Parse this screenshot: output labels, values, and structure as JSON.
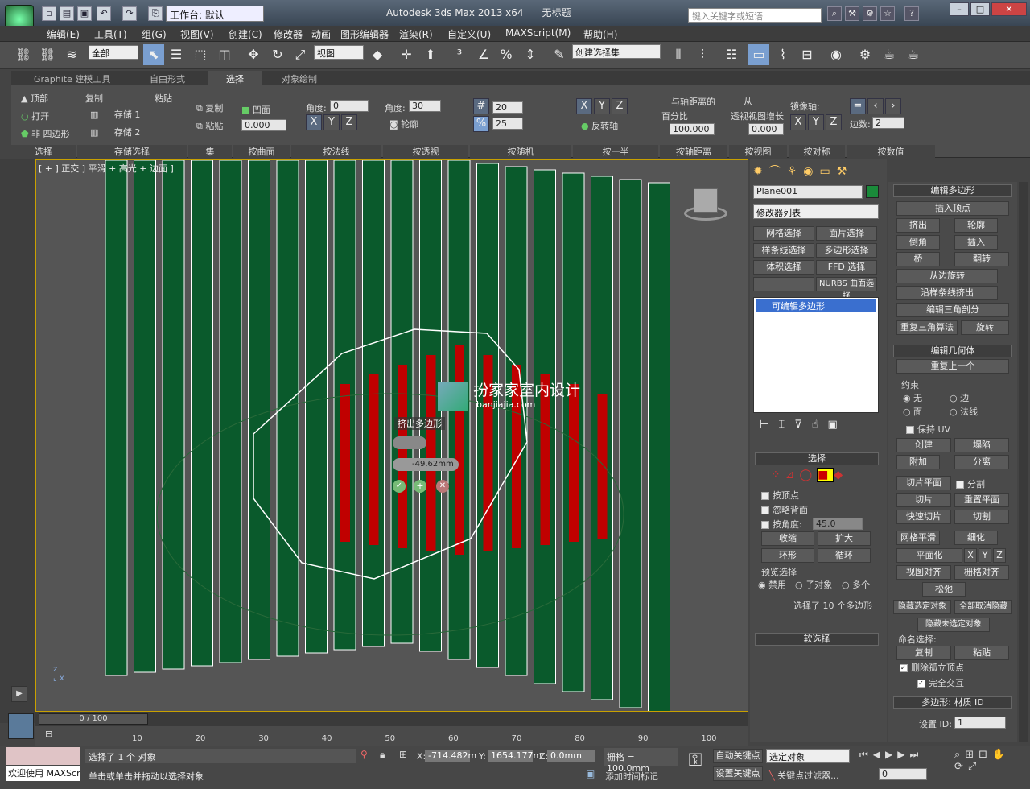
{
  "title": {
    "workspace": "工作台: 默认",
    "app": "Autodesk 3ds Max  2013 x64",
    "doc": "无标题",
    "search_placeholder": "键入关键字或短语"
  },
  "menu": [
    "编辑(E)",
    "工具(T)",
    "组(G)",
    "视图(V)",
    "创建(C)",
    "修改器",
    "动画",
    "图形编辑器",
    "渲染(R)",
    "自定义(U)",
    "MAXScript(M)",
    "帮助(H)"
  ],
  "toolbar": {
    "filter": "全部",
    "refcoord": "视图",
    "selset": "创建选择集"
  },
  "ribbon_tabs": [
    "Graphite 建模工具",
    "自由形式",
    "选择",
    "对象绘制"
  ],
  "ribbon": {
    "top": "顶部",
    "open": "打开",
    "non_quad": "非 四边形",
    "copy": "复制",
    "paste": "粘贴",
    "store1": "存储 1",
    "store2": "存储 2",
    "copy2": "复制",
    "paste2": "粘贴",
    "concave": "凹面",
    "concave_val": "0.000",
    "angle1": "角度:",
    "angle1_val": "0",
    "angle2": "角度:",
    "angle2_val": "30",
    "contour": "轮廓",
    "grid_val": "20",
    "pct_val": "25",
    "flip_axis": "反转轴",
    "dist_title": "与轴距离的",
    "dist_pct": "百分比",
    "dist_val": "100.000",
    "from": "从",
    "persp_grow": "透视视图增长",
    "persp_val": "0.000",
    "mirror_axis": "镜像轴:",
    "sides": "边数:",
    "sides_val": "2",
    "groups": [
      "选择",
      "存储选择",
      "集",
      "按曲面",
      "按法线",
      "按透视",
      "按随机",
      "按一半",
      "按轴距离",
      "按视图",
      "按对称",
      "按数值"
    ]
  },
  "viewport": {
    "label": "[ + ] 正交 ] 平滑 + 高光 + 边面 ]",
    "caddy_title": "挤出多边形",
    "caddy_value": "-49.62mm",
    "watermark": "扮家家室内设计",
    "watermark_url": "banjiajia.com"
  },
  "command": {
    "object_name": "Plane001",
    "modlist": "修改器列表",
    "mods": [
      "网格选择",
      "面片选择",
      "样条线选择",
      "多边形选择",
      "体积选择",
      "FFD 选择",
      "",
      "NURBS 曲面选择"
    ],
    "stack_item": "可编辑多边形"
  },
  "selection_rollout": {
    "title": "选择",
    "by_vertex": "按顶点",
    "ignore_back": "忽略背面",
    "by_angle": "按角度:",
    "angle_val": "45.0",
    "shrink": "收缩",
    "grow": "扩大",
    "ring": "环形",
    "loop": "循环",
    "preview": "预览选择",
    "off": "禁用",
    "subobj": "子对象",
    "multi": "多个",
    "status": "选择了 10 个多边形",
    "soft": "软选择"
  },
  "edit_poly": {
    "title": "编辑多边形",
    "insert_vertex": "插入顶点",
    "extrude": "挤出",
    "outline": "轮廓",
    "bevel": "倒角",
    "inset": "插入",
    "bridge": "桥",
    "flip": "翻转",
    "hinge": "从边旋转",
    "spline": "沿样条线挤出",
    "edit_tri": "编辑三角剖分",
    "retri": "重复三角算法",
    "turn": "旋转"
  },
  "edit_geom": {
    "title": "编辑几何体",
    "repeat": "重复上一个",
    "constraint": "约束",
    "none": "无",
    "edge": "边",
    "face": "面",
    "normal": "法线",
    "preserve_uv": "保持 UV",
    "create": "创建",
    "collapse": "塌陷",
    "attach": "附加",
    "detach": "分离",
    "slice_plane": "切片平面",
    "split": "分割",
    "slice": "切片",
    "reset_plane": "重置平面",
    "quickslice": "快速切片",
    "cut": "切割",
    "msmooth": "网格平滑",
    "tessellate": "细化",
    "planar": "平面化",
    "x": "X",
    "y": "Y",
    "z": "Z",
    "view_align": "视图对齐",
    "grid_align": "栅格对齐",
    "relax": "松弛",
    "hide_sel": "隐藏选定对象",
    "unhide_all": "全部取消隐藏",
    "hide_unsel": "隐藏未选定对象",
    "named_sel": "命名选择:",
    "copy": "复制",
    "paste": "粘贴",
    "del_iso": "删除孤立顶点",
    "full_int": "完全交互"
  },
  "matid": {
    "title": "多边形: 材质 ID",
    "set_id": "设置 ID:",
    "set_val": "1"
  },
  "timeline": {
    "frame": "0 / 100",
    "ticks": [
      "10",
      "20",
      "30",
      "40",
      "50",
      "60",
      "70",
      "80",
      "90",
      "100"
    ]
  },
  "status": {
    "welcome": "欢迎使用 MAXScr",
    "selected": "选择了 1 个 对象",
    "prompt": "单击或单击并拖动以选择对象",
    "x_label": "X:",
    "x": "-714.482m",
    "y_label": "Y:",
    "y": "1654.177m",
    "z_label": "Z:",
    "z": "0.0mm",
    "grid": "栅格 = 100.0mm",
    "add_time_tag": "添加时间标记",
    "autokey": "自动关键点",
    "selected_obj": "选定对象",
    "setkey": "设置关键点",
    "key_filter": "关键点过滤器...",
    "frame_val": "0"
  }
}
